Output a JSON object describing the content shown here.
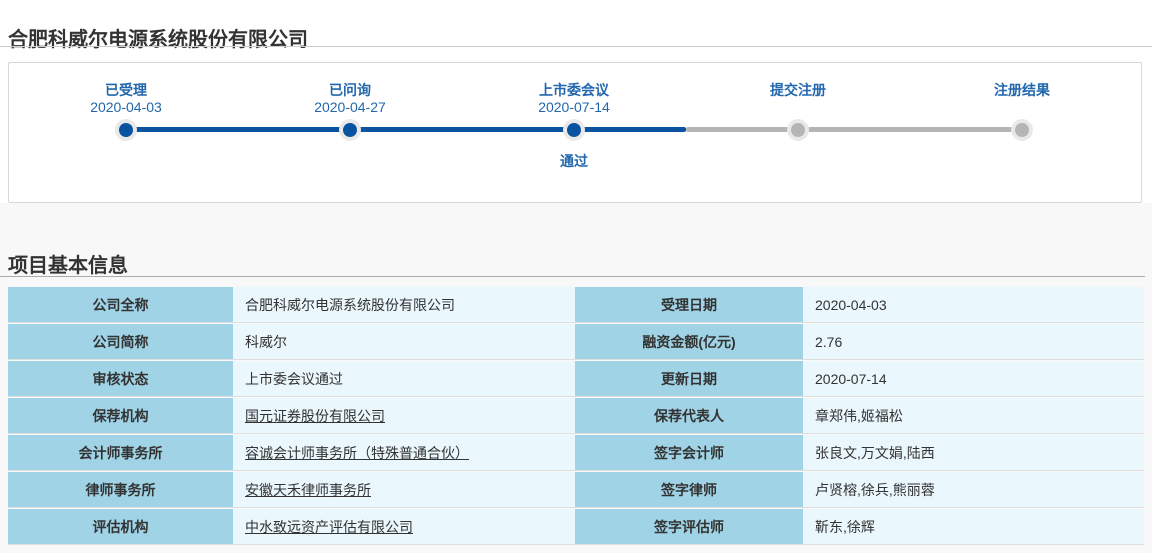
{
  "page": {
    "title": "合肥科威尔电源系统股份有限公司"
  },
  "colors": {
    "accent_blue_text": "#2267ae",
    "timeline_active": "#0a53a0",
    "timeline_inactive": "#b5b5b5",
    "table_label_bg": "#9fd3e5",
    "table_value_bg": "#eaf7fc"
  },
  "timeline": {
    "stages": [
      {
        "name": "已受理",
        "date": "2020-04-03",
        "state": "done",
        "result": ""
      },
      {
        "name": "已问询",
        "date": "2020-04-27",
        "state": "done",
        "result": ""
      },
      {
        "name": "上市委会议",
        "date": "2020-07-14",
        "state": "done",
        "result": "通过"
      },
      {
        "name": "提交注册",
        "date": "",
        "state": "pending",
        "result": ""
      },
      {
        "name": "注册结果",
        "date": "",
        "state": "pending",
        "result": ""
      }
    ]
  },
  "section": {
    "title": "项目基本信息"
  },
  "table": {
    "rows": [
      {
        "label_left": "公司全称",
        "value_left": "合肥科威尔电源系统股份有限公司",
        "left_link": false,
        "label_right": "受理日期",
        "value_right": "2020-04-03"
      },
      {
        "label_left": "公司简称",
        "value_left": "科威尔",
        "left_link": false,
        "label_right": "融资金额(亿元)",
        "value_right": "2.76"
      },
      {
        "label_left": "审核状态",
        "value_left": "上市委会议通过",
        "left_link": false,
        "label_right": "更新日期",
        "value_right": "2020-07-14"
      },
      {
        "label_left": "保荐机构",
        "value_left": "国元证券股份有限公司",
        "left_link": true,
        "label_right": "保荐代表人",
        "value_right": "章郑伟,姬福松"
      },
      {
        "label_left": "会计师事务所",
        "value_left": "容诚会计师事务所（特殊普通合伙）",
        "left_link": true,
        "label_right": "签字会计师",
        "value_right": "张良文,万文娟,陆西"
      },
      {
        "label_left": "律师事务所",
        "value_left": "安徽天禾律师事务所",
        "left_link": true,
        "label_right": "签字律师",
        "value_right": "卢贤榕,徐兵,熊丽蓉"
      },
      {
        "label_left": "评估机构",
        "value_left": "中水致远资产评估有限公司",
        "left_link": true,
        "label_right": "签字评估师",
        "value_right": "靳东,徐辉"
      }
    ]
  }
}
